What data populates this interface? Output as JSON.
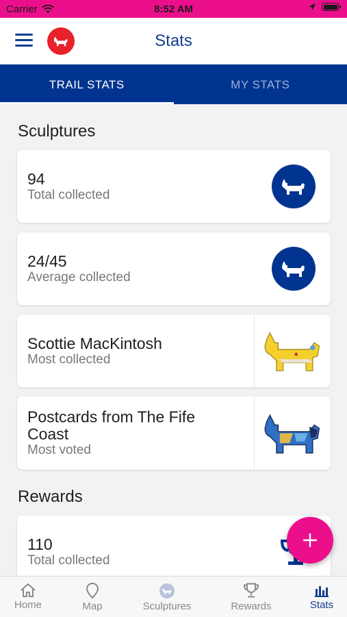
{
  "status_bar": {
    "carrier": "Carrier",
    "time": "8:52 AM"
  },
  "header": {
    "title": "Stats",
    "menu_icon": "hamburger-menu-icon",
    "logo_icon": "scottie-dog-logo-icon"
  },
  "tabs": [
    {
      "label": "TRAIL STATS",
      "active": true
    },
    {
      "label": "MY STATS",
      "active": false
    }
  ],
  "sculptures": {
    "title": "Sculptures",
    "cards": [
      {
        "value": "94",
        "label": "Total collected",
        "icon": "scottie-dog-icon"
      },
      {
        "value": "24/45",
        "label": "Average collected",
        "icon": "scottie-dog-icon"
      },
      {
        "value": "Scottie MacKintosh",
        "label": "Most collected",
        "icon": "yellow-scottie-sculpture-image"
      },
      {
        "value": "Postcards from The Fife Coast",
        "label": "Most voted",
        "icon": "blue-scottie-sculpture-image"
      }
    ]
  },
  "rewards": {
    "title": "Rewards",
    "cards": [
      {
        "value": "110",
        "label": "Total collected",
        "icon": "trophy-icon"
      }
    ]
  },
  "fab": {
    "icon": "plus-icon"
  },
  "bottom_nav": [
    {
      "label": "Home",
      "icon": "home-icon",
      "active": false
    },
    {
      "label": "Map",
      "icon": "map-pin-icon",
      "active": false
    },
    {
      "label": "Sculptures",
      "icon": "sculptures-icon",
      "active": false
    },
    {
      "label": "Rewards",
      "icon": "trophy-icon",
      "active": false
    },
    {
      "label": "Stats",
      "icon": "bar-chart-icon",
      "active": true
    }
  ],
  "colors": {
    "accent": "#ec0f8c",
    "primary": "#003490",
    "logo": "#e8212b"
  }
}
